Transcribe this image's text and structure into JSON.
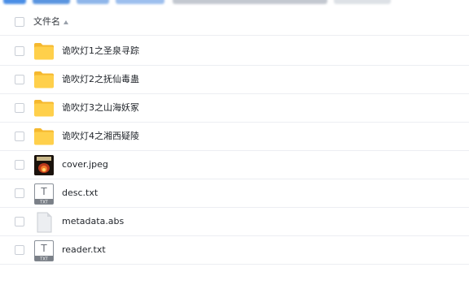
{
  "header": {
    "column_name": "文件名",
    "sort_icon": "sort-ascending-icon"
  },
  "files": [
    {
      "name": "诡吹灯1之圣泉寻踪",
      "type": "folder",
      "icon": "folder-icon"
    },
    {
      "name": "诡吹灯2之抚仙毒蛊",
      "type": "folder",
      "icon": "folder-icon"
    },
    {
      "name": "诡吹灯3之山海妖冢",
      "type": "folder",
      "icon": "folder-icon"
    },
    {
      "name": "诡吹灯4之湘西疑陵",
      "type": "folder",
      "icon": "folder-icon"
    },
    {
      "name": "cover.jpeg",
      "type": "image",
      "icon": "image-thumbnail-icon"
    },
    {
      "name": "desc.txt",
      "type": "txt",
      "icon": "txt-file-icon"
    },
    {
      "name": "metadata.abs",
      "type": "generic",
      "icon": "generic-file-icon"
    },
    {
      "name": "reader.txt",
      "type": "txt",
      "icon": "txt-file-icon"
    }
  ],
  "colors": {
    "folder": "#ffd04b",
    "folder_back": "#f5b82e",
    "row_border": "#eceef2",
    "text": "#1f2329",
    "txt_badge": "#7a7f87"
  }
}
